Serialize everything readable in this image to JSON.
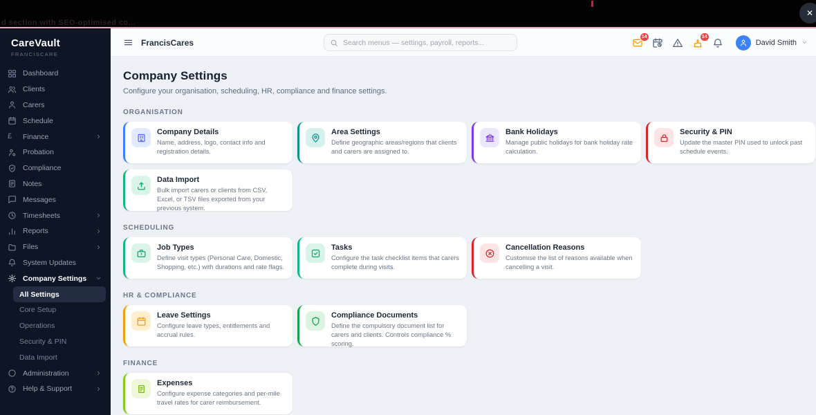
{
  "topbar": {
    "hidden_text": "d section with SEO-optimised co...",
    "close_glyph": "✕"
  },
  "sidebar": {
    "brand": "CareVault",
    "brand_sub": "FRANCISCARE",
    "items": [
      {
        "label": "Dashboard",
        "icon": "grid-icon"
      },
      {
        "label": "Clients",
        "icon": "users-icon"
      },
      {
        "label": "Carers",
        "icon": "user-icon"
      },
      {
        "label": "Schedule",
        "icon": "calendar-icon"
      },
      {
        "label": "Finance",
        "icon": "pound-icon",
        "chevron": "right"
      },
      {
        "label": "Probation",
        "icon": "person-dot-icon"
      },
      {
        "label": "Compliance",
        "icon": "shield-check-icon"
      },
      {
        "label": "Notes",
        "icon": "note-icon"
      },
      {
        "label": "Messages",
        "icon": "message-icon"
      },
      {
        "label": "Timesheets",
        "icon": "clock-icon",
        "chevron": "right"
      },
      {
        "label": "Reports",
        "icon": "bar-chart-icon",
        "chevron": "right"
      },
      {
        "label": "Files",
        "icon": "folder-icon",
        "chevron": "right"
      },
      {
        "label": "System Updates",
        "icon": "bell-icon"
      },
      {
        "label": "Company Settings",
        "icon": "gear-icon",
        "chevron": "down",
        "bold": true
      },
      {
        "label": "All Settings",
        "sub": true,
        "active": true
      },
      {
        "label": "Core Setup",
        "sub": true
      },
      {
        "label": "Operations",
        "sub": true
      },
      {
        "label": "Security & PIN",
        "sub": true
      },
      {
        "label": "Data Import",
        "sub": true
      },
      {
        "label": "Administration",
        "icon": "circle-icon",
        "chevron": "right"
      },
      {
        "label": "Help & Support",
        "icon": "help-icon",
        "chevron": "right"
      }
    ]
  },
  "header": {
    "app_title": "FrancisCares",
    "search_placeholder": "Search menus — settings, payroll, reports...",
    "icons": [
      {
        "name": "mail-icon",
        "badge": "14",
        "tint": true
      },
      {
        "name": "calendar-clock-icon"
      },
      {
        "name": "alert-triangle-icon"
      },
      {
        "name": "cake-icon",
        "badge": "14",
        "tint": true
      },
      {
        "name": "bell-icon"
      }
    ],
    "user": {
      "name": "David Smith"
    }
  },
  "page": {
    "title": "Company Settings",
    "subtitle": "Configure your organisation, scheduling, HR, compliance and finance settings.",
    "sections": [
      {
        "heading": "ORGANISATION",
        "cards": [
          {
            "title": "Company Details",
            "desc": "Name, address, logo, contact info and registration details.",
            "accent": "#3b82f6",
            "icon": "building-icon",
            "icon_color": "#4f6ef7",
            "icon_bg": "#e3e9fc"
          },
          {
            "title": "Area Settings",
            "desc": "Define geographic areas/regions that clients and carers are assigned to.",
            "accent": "#0d9488",
            "icon": "map-pin-icon",
            "icon_color": "#0d9488",
            "icon_bg": "#d7f0ee"
          },
          {
            "title": "Bank Holidays",
            "desc": "Manage public holidays for bank holiday rate calculation.",
            "accent": "#7c3aed",
            "icon": "bank-icon",
            "icon_color": "#7c3aed",
            "icon_bg": "#ece6fb"
          },
          {
            "title": "Security & PIN",
            "desc": "Update the master PIN used to unlock past schedule events.",
            "accent": "#dc2626",
            "icon": "lock-icon",
            "icon_color": "#dc2626",
            "icon_bg": "#fce4e4"
          },
          {
            "title": "Data Import",
            "desc": "Bulk import carers or clients from CSV, Excel, or TSV files exported from your previous system.",
            "accent": "#10b981",
            "icon": "upload-icon",
            "icon_color": "#10a775",
            "icon_bg": "#d9f3e7"
          }
        ]
      },
      {
        "heading": "SCHEDULING",
        "cards": [
          {
            "title": "Job Types",
            "desc": "Define visit types (Personal Care, Domestic, Shopping, etc.) with durations and rate flags.",
            "accent": "#10b981",
            "icon": "briefcase-icon",
            "icon_color": "#10a775",
            "icon_bg": "#d9f3e7"
          },
          {
            "title": "Tasks",
            "desc": "Configure the task checklist items that carers complete during visits.",
            "accent": "#10b981",
            "icon": "check-square-icon",
            "icon_color": "#10a775",
            "icon_bg": "#d9f3e7"
          },
          {
            "title": "Cancellation Reasons",
            "desc": "Customise the list of reasons available when cancelling a visit.",
            "accent": "#dc2626",
            "icon": "x-circle-icon",
            "icon_color": "#dc2626",
            "icon_bg": "#fce4e4"
          }
        ]
      },
      {
        "heading": "HR & COMPLIANCE",
        "cards": [
          {
            "title": "Leave Settings",
            "desc": "Configure leave types, entitlements and accrual rules.",
            "accent": "#f59e0b",
            "icon": "calendar-icon",
            "icon_color": "#f59e0b",
            "icon_bg": "#fdeecd"
          },
          {
            "title": "Compliance Documents",
            "desc": "Define the compulsory document list for carers and clients. Controls compliance % scoring.",
            "accent": "#16a34a",
            "icon": "shield-icon",
            "icon_color": "#16a34a",
            "icon_bg": "#dcf3e2"
          }
        ]
      },
      {
        "heading": "FINANCE",
        "cards": [
          {
            "title": "Expenses",
            "desc": "Configure expense categories and per-mile travel rates for carer reimbursement.",
            "accent": "#84cc16",
            "icon": "receipt-icon",
            "icon_color": "#74b30e",
            "icon_bg": "#eef8d8"
          }
        ]
      }
    ]
  }
}
